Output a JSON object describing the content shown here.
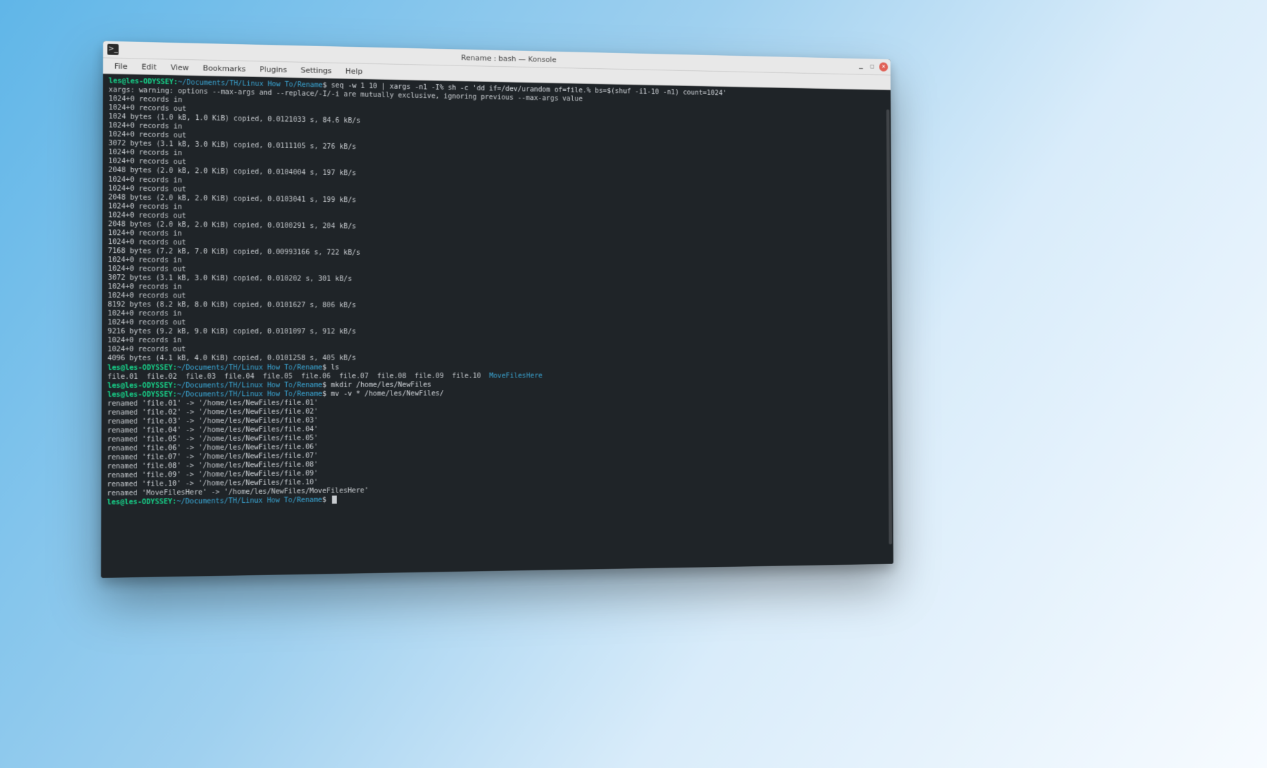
{
  "window": {
    "title": "Rename : bash — Konsole",
    "icon_glyph": ">_"
  },
  "menubar": [
    "File",
    "Edit",
    "View",
    "Bookmarks",
    "Plugins",
    "Settings",
    "Help"
  ],
  "prompts": {
    "user_host": "les@les-ODYSSEY",
    "path": "~/Documents/TH/Linux How To/Rename",
    "sigil": "$"
  },
  "commands": {
    "cmd1": "seq -w 1 10 | xargs -n1 -I% sh -c 'dd if=/dev/urandom of=file.% bs=$(shuf -i1-10 -n1) count=1024'",
    "cmd2": "ls",
    "cmd3": "mkdir /home/les/NewFiles",
    "cmd4": "mv -v * /home/les/NewFiles/"
  },
  "xargs_warning": "xargs: warning: options --max-args and --replace/-I/-i are mutually exclusive, ignoring previous --max-args value",
  "dd_blocks": [
    {
      "rec_in": "1024+0 records in",
      "rec_out": "1024+0 records out",
      "stat": "1024 bytes (1.0 kB, 1.0 KiB) copied, 0.0121033 s, 84.6 kB/s"
    },
    {
      "rec_in": "1024+0 records in",
      "rec_out": "1024+0 records out",
      "stat": "3072 bytes (3.1 kB, 3.0 KiB) copied, 0.0111105 s, 276 kB/s"
    },
    {
      "rec_in": "1024+0 records in",
      "rec_out": "1024+0 records out",
      "stat": "2048 bytes (2.0 kB, 2.0 KiB) copied, 0.0104004 s, 197 kB/s"
    },
    {
      "rec_in": "1024+0 records in",
      "rec_out": "1024+0 records out",
      "stat": "2048 bytes (2.0 kB, 2.0 KiB) copied, 0.0103041 s, 199 kB/s"
    },
    {
      "rec_in": "1024+0 records in",
      "rec_out": "1024+0 records out",
      "stat": "2048 bytes (2.0 kB, 2.0 KiB) copied, 0.0100291 s, 204 kB/s"
    },
    {
      "rec_in": "1024+0 records in",
      "rec_out": "1024+0 records out",
      "stat": "7168 bytes (7.2 kB, 7.0 KiB) copied, 0.00993166 s, 722 kB/s"
    },
    {
      "rec_in": "1024+0 records in",
      "rec_out": "1024+0 records out",
      "stat": "3072 bytes (3.1 kB, 3.0 KiB) copied, 0.010202 s, 301 kB/s"
    },
    {
      "rec_in": "1024+0 records in",
      "rec_out": "1024+0 records out",
      "stat": "8192 bytes (8.2 kB, 8.0 KiB) copied, 0.0101627 s, 806 kB/s"
    },
    {
      "rec_in": "1024+0 records in",
      "rec_out": "1024+0 records out",
      "stat": "9216 bytes (9.2 kB, 9.0 KiB) copied, 0.0101097 s, 912 kB/s"
    },
    {
      "rec_in": "1024+0 records in",
      "rec_out": "1024+0 records out",
      "stat": "4096 bytes (4.1 kB, 4.0 KiB) copied, 0.0101258 s, 405 kB/s"
    }
  ],
  "ls_output": {
    "files": [
      "file.01",
      "file.02",
      "file.03",
      "file.04",
      "file.05",
      "file.06",
      "file.07",
      "file.08",
      "file.09",
      "file.10"
    ],
    "dir": "MoveFilesHere"
  },
  "mv_output": [
    "renamed 'file.01' -> '/home/les/NewFiles/file.01'",
    "renamed 'file.02' -> '/home/les/NewFiles/file.02'",
    "renamed 'file.03' -> '/home/les/NewFiles/file.03'",
    "renamed 'file.04' -> '/home/les/NewFiles/file.04'",
    "renamed 'file.05' -> '/home/les/NewFiles/file.05'",
    "renamed 'file.06' -> '/home/les/NewFiles/file.06'",
    "renamed 'file.07' -> '/home/les/NewFiles/file.07'",
    "renamed 'file.08' -> '/home/les/NewFiles/file.08'",
    "renamed 'file.09' -> '/home/les/NewFiles/file.09'",
    "renamed 'file.10' -> '/home/les/NewFiles/file.10'",
    "renamed 'MoveFilesHere' -> '/home/les/NewFiles/MoveFilesHere'"
  ]
}
